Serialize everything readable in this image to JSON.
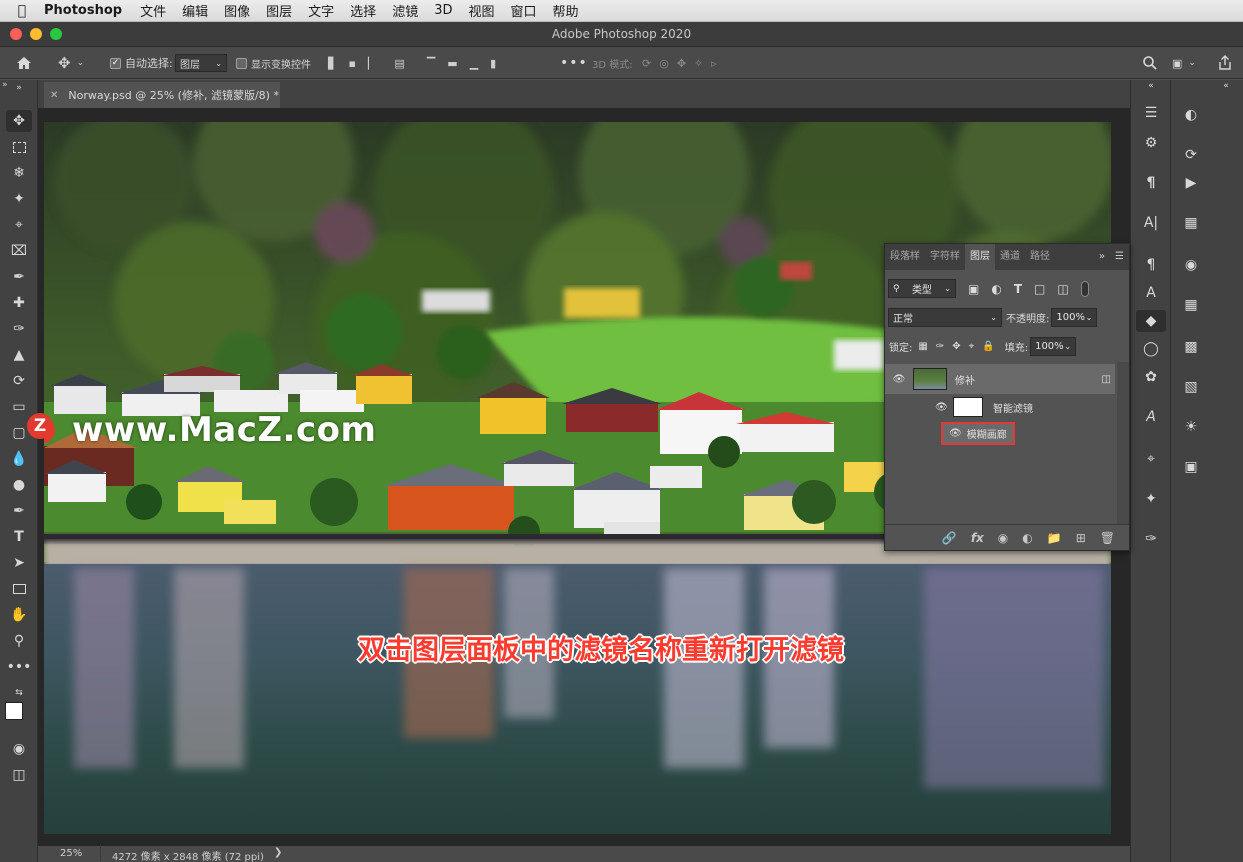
{
  "menubar": {
    "app_name": "Photoshop",
    "items": [
      "文件",
      "编辑",
      "图像",
      "图层",
      "文字",
      "选择",
      "滤镜",
      "3D",
      "视图",
      "窗口",
      "帮助"
    ]
  },
  "window": {
    "title": "Adobe Photoshop 2020"
  },
  "options_bar": {
    "auto_select_label": "自动选择:",
    "auto_select_value": "图层",
    "show_transform_label": "显示变换控件",
    "mode_3d_label": "3D 模式:"
  },
  "document": {
    "tab_title": "Norway.psd @ 25% (修补, 滤镜蒙版/8) *",
    "zoom": "25%",
    "doc_info": "4272 像素 x 2848 像素 (72 ppi)"
  },
  "watermark": {
    "text": "www.MacZ.com",
    "logo_letter": "Z"
  },
  "caption": "双击图层面板中的滤镜名称重新打开滤镜",
  "layers_panel": {
    "tabs": [
      "段落样",
      "字符样",
      "图层",
      "通道",
      "路径"
    ],
    "active_tab": "图层",
    "filter_kind": "类型",
    "blend_mode": "正常",
    "opacity_label": "不透明度:",
    "opacity_value": "100%",
    "lock_label": "锁定:",
    "fill_label": "填充:",
    "fill_value": "100%",
    "layers": [
      {
        "name": "修补"
      },
      {
        "name": "智能滤镜"
      },
      {
        "name": "模糊画廊"
      }
    ]
  },
  "colors": {
    "highlight_box": "#e03a3a",
    "caption_text": "#ff3b30",
    "watermark_logo": "#e23a2f"
  }
}
